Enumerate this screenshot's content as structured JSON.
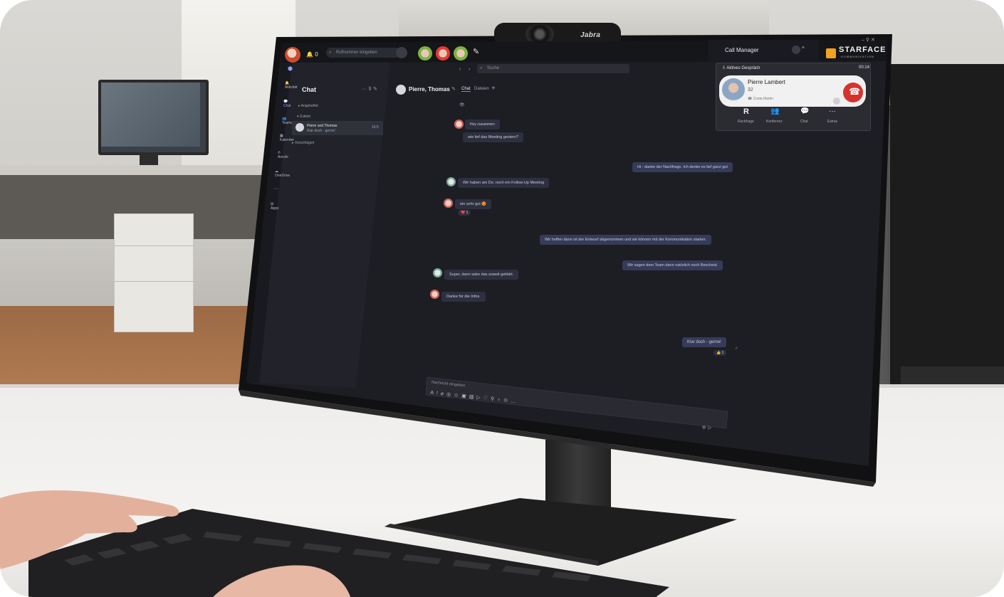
{
  "camera": {
    "brand": "Jabra"
  },
  "topbar": {
    "status_count": "0",
    "search_placeholder": "Rufnummer eingeben",
    "call_manager_label": "Call Manager",
    "starface_brand": "STARFACE",
    "starface_tagline": "KOMMUNIKATION"
  },
  "teams_header": {
    "search_placeholder": "Suche"
  },
  "rail": {
    "items": [
      "Aktivität",
      "Chat",
      "Teams",
      "Kalender",
      "Anrufe",
      "OneDrive",
      "Apps"
    ]
  },
  "chat_list": {
    "title": "Chat",
    "sections": [
      "Angeheftet",
      "Zuletzt",
      "Vorschlägen"
    ],
    "items": [
      {
        "name": "Pierre und Thomas",
        "preview": "Klar doch - gerne!",
        "time": "16:5"
      }
    ]
  },
  "conversation": {
    "title": "Pierre, Thomas",
    "tabs": [
      "Chat",
      "Dateien"
    ],
    "add_tab": "+",
    "messages": [
      {
        "from": "other",
        "text": "Hey zusammen"
      },
      {
        "from": "other",
        "text": "wie lief das Meeting gestern?"
      },
      {
        "from": "me",
        "text": "Hi - danke der Nachfrage. Ich denke es lief ganz gut"
      },
      {
        "from": "other",
        "text": "Wir haben am Do. noch ein Follow-Up Meeting"
      },
      {
        "from": "other",
        "text": "ein sehr gut 😍",
        "reaction": "❤️ 1"
      },
      {
        "from": "me",
        "text": "Wir hoffen dann ist der Entwurf abgenommen und wir können mit der Kommunikation starten."
      },
      {
        "from": "me",
        "text": "Wir sagen dem Team dann natürlich noch Bescheid."
      },
      {
        "from": "other",
        "text": "Super, dann wäre das soweit geklärt."
      },
      {
        "from": "other",
        "text": "Danke für die Infos."
      },
      {
        "from": "me",
        "text": "Klar doch - gerne!",
        "reaction": "👍 1"
      }
    ],
    "composer_placeholder": "Nachricht eingeben"
  },
  "call_popup": {
    "header": "Aktives Gespräch",
    "timer": "00:14",
    "caller_name": "Pierre Lambert",
    "caller_number": "32",
    "caller_status": "Costa Martin",
    "actions": [
      {
        "icon": "R",
        "label": "Rückfrage"
      },
      {
        "icon": "👥",
        "label": "Konferenz"
      },
      {
        "icon": "💬",
        "label": "Chat"
      },
      {
        "icon": "···",
        "label": "Extras"
      }
    ]
  },
  "colors": {
    "screen_bg": "#1f1f24",
    "sidebar_bg": "#24252b",
    "bubble_bg": "#2e3040",
    "hangup_red": "#d6332e",
    "starface_orange": "#f3a21d",
    "accent": "#7b83eb"
  }
}
